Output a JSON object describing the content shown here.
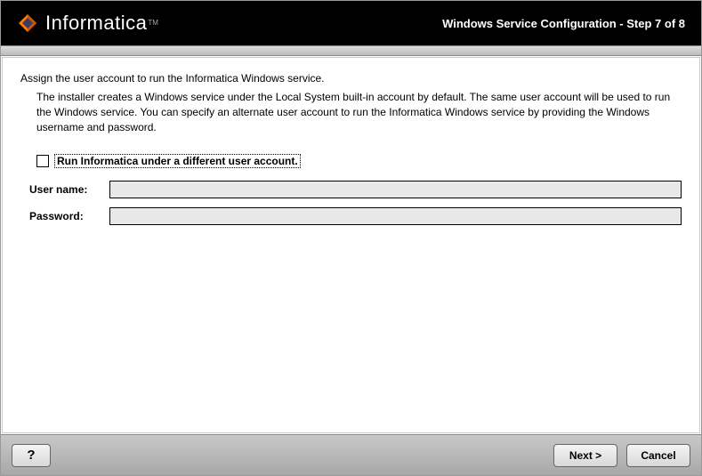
{
  "header": {
    "brand": "Informatica",
    "tm": "TM",
    "title": "Windows Service Configuration - Step 7 of 8"
  },
  "content": {
    "instruction": "Assign the user account to run the Informatica Windows service.",
    "description": "The installer creates a Windows service under the Local System built-in account by default. The same user account will be used to run the Windows service. You can specify an alternate user account to run the Informatica Windows service by providing the Windows username and password.",
    "checkbox_label": "Run Informatica under a different user account.",
    "username_label": "User name:",
    "username_value": "",
    "password_label": "Password:",
    "password_value": ""
  },
  "footer": {
    "help": "?",
    "next": "Next >",
    "cancel": "Cancel"
  }
}
